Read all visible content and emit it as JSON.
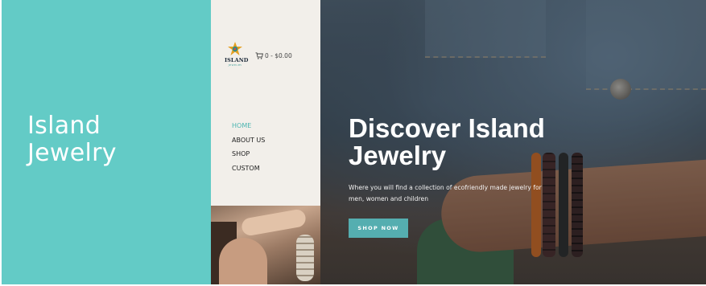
{
  "brand": {
    "site_title_line1": "Island",
    "site_title_line2": "Jewelry",
    "logo_text": "ISLAND",
    "logo_subtext": "JEWELRY",
    "accent_color": "#63cbc6"
  },
  "cart": {
    "icon": "cart-icon",
    "summary": "0 - $0.00"
  },
  "nav": {
    "items": [
      {
        "label": "HOME",
        "active": true
      },
      {
        "label": "ABOUT US",
        "active": false
      },
      {
        "label": "SHOP",
        "active": false
      },
      {
        "label": "CUSTOM",
        "active": false
      }
    ]
  },
  "hero": {
    "title_line1": "Discover Island",
    "title_line2": "Jewelry",
    "description": "Where you will find a collection of ecofriendly made jewelry for men, women and children",
    "cta_label": "SHOP NOW",
    "cta_color": "#55aeb0"
  }
}
